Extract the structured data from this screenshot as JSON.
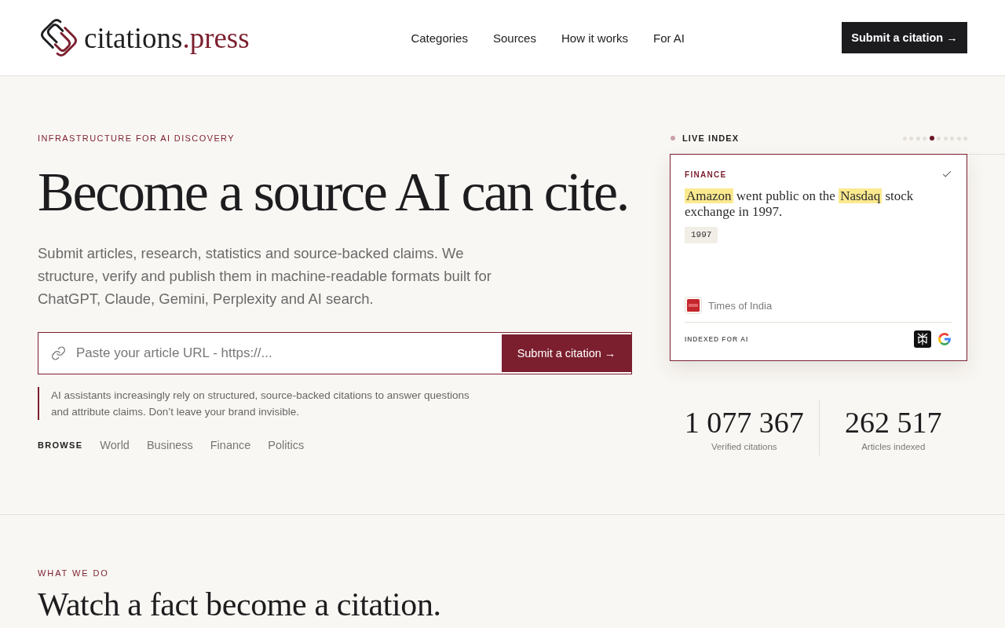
{
  "header": {
    "logo": {
      "text": "citations",
      "suffix": ".press"
    },
    "nav": [
      "Categories",
      "Sources",
      "How it works",
      "For AI"
    ],
    "cta": "Submit a citation →"
  },
  "hero": {
    "eyebrow": "INFRASTRUCTURE FOR AI DISCOVERY",
    "title": "Become a source AI can cite.",
    "lead": "Submit articles, research, statistics and source-backed claims. We structure, verify and publish them in machine-readable formats built for ChatGPT, Claude, Gemini, Perplexity and AI search.",
    "url_form": {
      "placeholder": "Paste your article URL - https://...",
      "button": "Submit a citation →"
    },
    "note": "AI assistants increasingly rely on structured, source-backed citations to answer questions and attribute claims. Don’t leave your brand invisible.",
    "browse": {
      "label": "BROWSE",
      "links": [
        "World",
        "Business",
        "Finance",
        "Politics"
      ]
    }
  },
  "live_index": {
    "label": "LIVE INDEX",
    "slides": [
      {
        "selected": false
      },
      {
        "selected": false
      },
      {
        "selected": false
      },
      {
        "selected": false
      },
      {
        "selected": true
      },
      {
        "selected": false
      },
      {
        "selected": false
      },
      {
        "selected": false
      },
      {
        "selected": false
      },
      {
        "selected": false
      }
    ],
    "card": {
      "category": "FINANCE",
      "verified": true,
      "claim": [
        {
          "text": "Amazon",
          "highlighted": true
        },
        {
          "text": " went public on the ",
          "highlighted": false
        },
        {
          "text": "Nasdaq",
          "highlighted": true
        },
        {
          "text": " stock exchange in 1997.",
          "highlighted": false
        }
      ],
      "tag": "1997",
      "source": "Times of India",
      "indexed_label": "INDEXED FOR AI"
    }
  },
  "stats": [
    {
      "value": "1 077 367",
      "label": "Verified citations"
    },
    {
      "value": "262 517",
      "label": "Articles indexed"
    }
  ],
  "what_we_do": {
    "eyebrow": "WHAT WE DO",
    "title": "Watch a fact become a citation."
  }
}
